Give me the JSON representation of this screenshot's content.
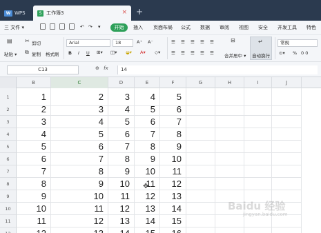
{
  "titlebar": {
    "app_tab": "WPS",
    "doc_tab": "工作簿3",
    "close_glyph": "×",
    "add_tab_glyph": "+"
  },
  "menu": {
    "file": "三 文件 ▾",
    "items": [
      "开始",
      "插入",
      "页面布局",
      "公式",
      "数据",
      "审阅",
      "视图",
      "安全",
      "开发工具",
      "特色"
    ]
  },
  "ribbon": {
    "cut": "剪切",
    "paste": "粘贴 ▾",
    "copy": "复制",
    "format_painter": "格式刷",
    "font_name": "Arial",
    "font_size": "18",
    "bold": "B",
    "italic": "I",
    "underline": "U",
    "merge_center": "合并居中 ▾",
    "wrap_text": "自动换行",
    "number_format": "常规",
    "percent": "%",
    "thousands": "0 0"
  },
  "formula_bar": {
    "cell_ref": "C13",
    "fx": "fx",
    "value": "14"
  },
  "columns": [
    "B",
    "C",
    "D",
    "E",
    "F",
    "G",
    "H",
    "I",
    "J"
  ],
  "selected_column": "C",
  "rows": [
    {
      "n": "1",
      "cells": [
        "1",
        "2",
        "3",
        "4",
        "5"
      ]
    },
    {
      "n": "2",
      "cells": [
        "2",
        "3",
        "4",
        "5",
        "6"
      ]
    },
    {
      "n": "3",
      "cells": [
        "3",
        "4",
        "5",
        "6",
        "7"
      ]
    },
    {
      "n": "4",
      "cells": [
        "4",
        "5",
        "6",
        "7",
        "8"
      ]
    },
    {
      "n": "5",
      "cells": [
        "5",
        "6",
        "7",
        "8",
        "9"
      ]
    },
    {
      "n": "6",
      "cells": [
        "6",
        "7",
        "8",
        "9",
        "10"
      ]
    },
    {
      "n": "7",
      "cells": [
        "7",
        "8",
        "9",
        "10",
        "11"
      ]
    },
    {
      "n": "8",
      "cells": [
        "8",
        "9",
        "10",
        "11",
        "12"
      ]
    },
    {
      "n": "9",
      "cells": [
        "9",
        "10",
        "11",
        "12",
        "13"
      ]
    },
    {
      "n": "10",
      "cells": [
        "10",
        "11",
        "12",
        "13",
        "14"
      ]
    },
    {
      "n": "11",
      "cells": [
        "11",
        "12",
        "13",
        "14",
        "15"
      ]
    },
    {
      "n": "12",
      "cells": [
        "12",
        "13",
        "14",
        "15",
        "16"
      ]
    }
  ],
  "watermark": {
    "main": "Baidu 经验",
    "sub": "jingyan.baidu.com"
  }
}
